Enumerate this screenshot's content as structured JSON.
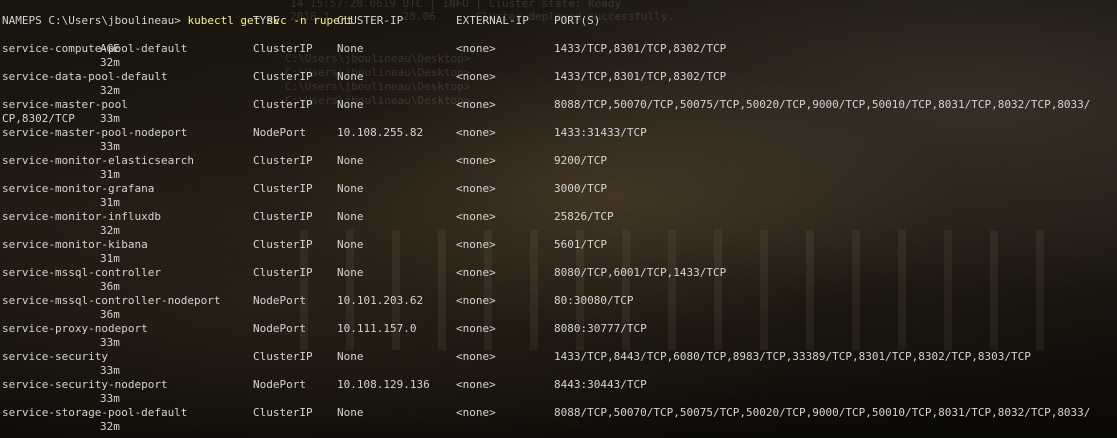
{
  "prompt": {
    "prefix": "PS C:\\Users\\jboulineau> ",
    "command": "kubectl get svc -n rupert"
  },
  "ghost_text": {
    "line1": "14 15:57:28.0619 UTC | INFO | Cluster state: Ready",
    "line2": "2018-1           28.06      Cluster deployed successfully.",
    "line3": "C:\\Users\\jboulineau\\Desktop>",
    "line4": "C:\\Users\\jboulineau\\Desktop>",
    "line5": "C:\\Users\\jboulineau\\Desktop>",
    "line6": "C:\\Users\\jboulineau\\Desktop>"
  },
  "headers": {
    "name": "NAME",
    "type": "TYPE",
    "cluster_ip": "CLUSTER-IP",
    "external_ip": "EXTERNAL-IP",
    "ports": "PORT(S)",
    "age": "AGE"
  },
  "services": [
    {
      "name": "service-compute-pool-default",
      "type": "ClusterIP",
      "cluster_ip": "None",
      "external_ip": "<none>",
      "ports": "1433/TCP,8301/TCP,8302/TCP",
      "age": "32m"
    },
    {
      "name": "service-data-pool-default",
      "type": "ClusterIP",
      "cluster_ip": "None",
      "external_ip": "<none>",
      "ports": "1433/TCP,8301/TCP,8302/TCP",
      "age": "32m"
    },
    {
      "name": "service-master-pool",
      "type": "ClusterIP",
      "cluster_ip": "None",
      "external_ip": "<none>",
      "ports": "8088/TCP,50070/TCP,50075/TCP,50020/TCP,9000/TCP,50010/TCP,8031/TCP,8032/TCP,8033/",
      "ports_wrap": "CP,8302/TCP",
      "age": "33m"
    },
    {
      "name": "service-master-pool-nodeport",
      "type": "NodePort",
      "cluster_ip": "10.108.255.82",
      "external_ip": "<none>",
      "ports": "1433:31433/TCP",
      "age": "33m"
    },
    {
      "name": "service-monitor-elasticsearch",
      "type": "ClusterIP",
      "cluster_ip": "None",
      "external_ip": "<none>",
      "ports": "9200/TCP",
      "age": "31m"
    },
    {
      "name": "service-monitor-grafana",
      "type": "ClusterIP",
      "cluster_ip": "None",
      "external_ip": "<none>",
      "ports": "3000/TCP",
      "age": "31m"
    },
    {
      "name": "service-monitor-influxdb",
      "type": "ClusterIP",
      "cluster_ip": "None",
      "external_ip": "<none>",
      "ports": "25826/TCP",
      "age": "32m"
    },
    {
      "name": "service-monitor-kibana",
      "type": "ClusterIP",
      "cluster_ip": "None",
      "external_ip": "<none>",
      "ports": "5601/TCP",
      "age": "31m"
    },
    {
      "name": "service-mssql-controller",
      "type": "ClusterIP",
      "cluster_ip": "None",
      "external_ip": "<none>",
      "ports": "8080/TCP,6001/TCP,1433/TCP",
      "age": "36m"
    },
    {
      "name": "service-mssql-controller-nodeport",
      "type": "NodePort",
      "cluster_ip": "10.101.203.62",
      "external_ip": "<none>",
      "ports": "80:30080/TCP",
      "age": "36m"
    },
    {
      "name": "service-proxy-nodeport",
      "type": "NodePort",
      "cluster_ip": "10.111.157.0",
      "external_ip": "<none>",
      "ports": "8080:30777/TCP",
      "age": "33m"
    },
    {
      "name": "service-security",
      "type": "ClusterIP",
      "cluster_ip": "None",
      "external_ip": "<none>",
      "ports": "1433/TCP,8443/TCP,6080/TCP,8983/TCP,33389/TCP,8301/TCP,8302/TCP,8303/TCP",
      "age": "33m"
    },
    {
      "name": "service-security-nodeport",
      "type": "NodePort",
      "cluster_ip": "10.108.129.136",
      "external_ip": "<none>",
      "ports": "8443:30443/TCP",
      "age": "33m"
    },
    {
      "name": "service-storage-pool-default",
      "type": "ClusterIP",
      "cluster_ip": "None",
      "external_ip": "<none>",
      "ports": "8088/TCP,50070/TCP,50075/TCP,50020/TCP,9000/TCP,50010/TCP,8031/TCP,8032/TCP,8033/",
      "age": "32m"
    }
  ]
}
